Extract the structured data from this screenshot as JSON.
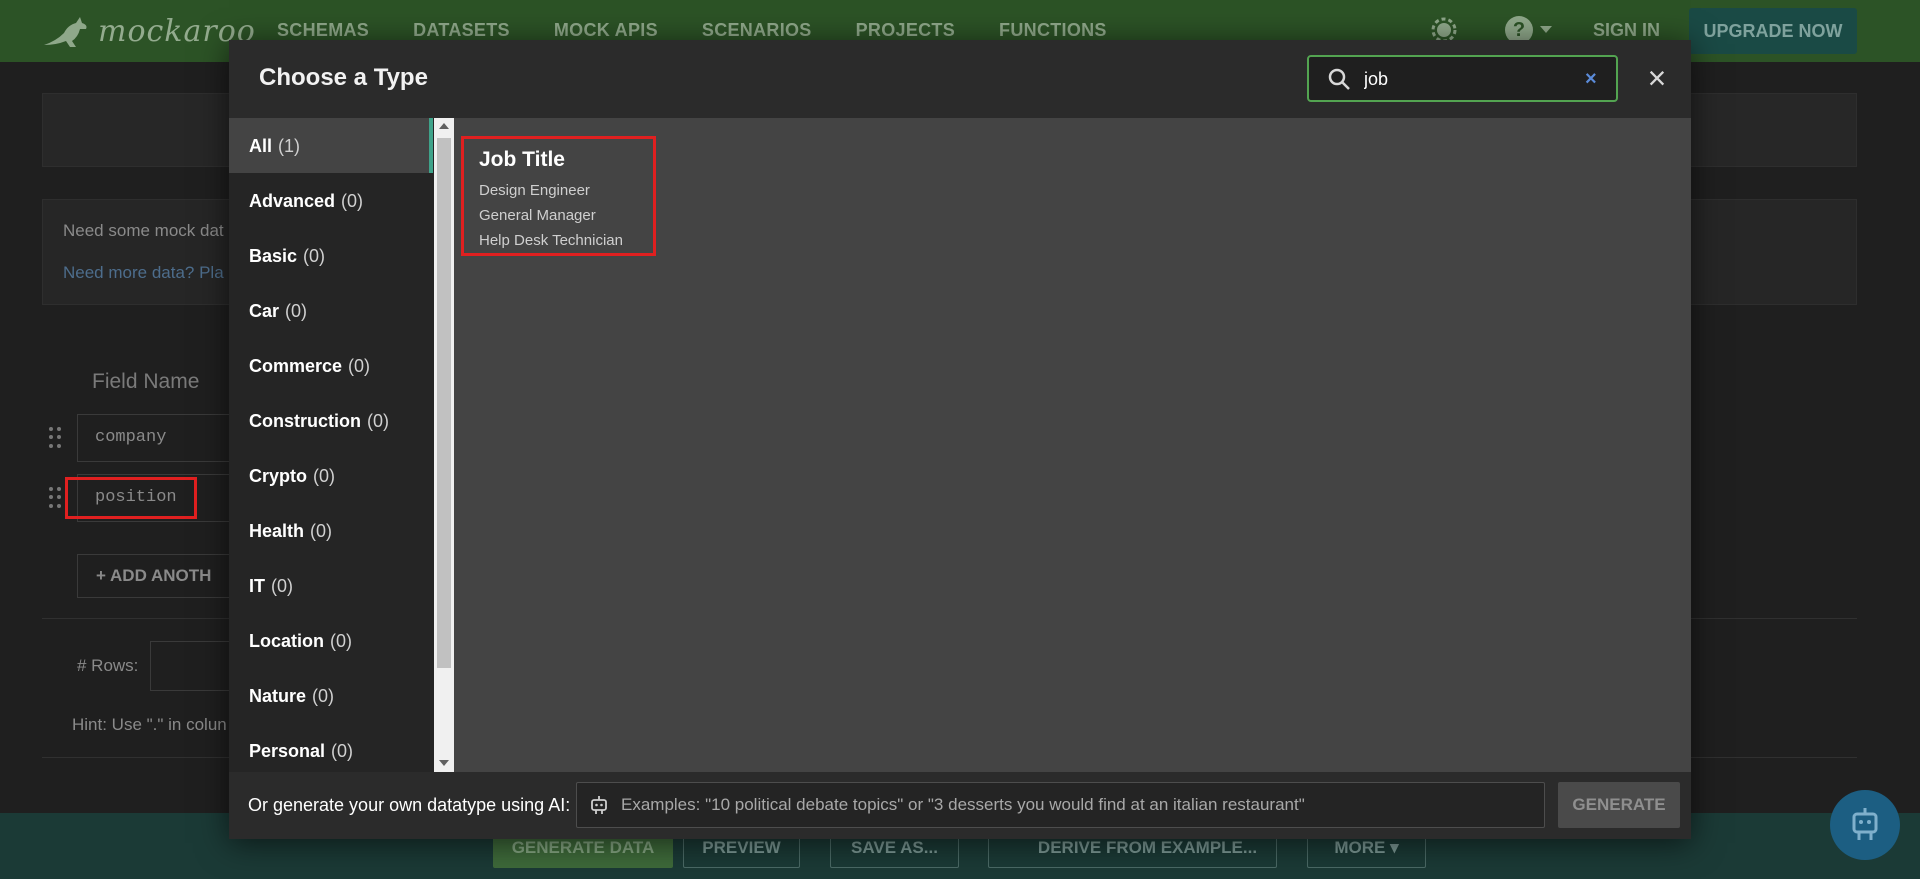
{
  "navbar": {
    "logo_text": "mockaroo",
    "links": [
      "SCHEMAS",
      "DATASETS",
      "MOCK APIS",
      "SCENARIOS",
      "PROJECTS",
      "FUNCTIONS"
    ],
    "sign_in": "SIGN IN",
    "upgrade": "UPGRADE NOW"
  },
  "background": {
    "notice_text": "Need some mock dat",
    "notice_link": "Need more data? Pla",
    "field_name_header": "Field Name",
    "fields": [
      "company",
      "position"
    ],
    "add_another": "ADD ANOTH",
    "rows_label": "# Rows:",
    "hint": "Hint: Use \".\" in colun"
  },
  "bottom_bar": {
    "generate_data": "GENERATE DATA",
    "preview": "PREVIEW",
    "save_as": "SAVE AS...",
    "derive": "DERIVE FROM EXAMPLE...",
    "more": "MORE"
  },
  "modal": {
    "title": "Choose a Type",
    "search_value": "job",
    "categories": [
      {
        "name": "All",
        "count": "(1)"
      },
      {
        "name": "Advanced",
        "count": "(0)"
      },
      {
        "name": "Basic",
        "count": "(0)"
      },
      {
        "name": "Car",
        "count": "(0)"
      },
      {
        "name": "Commerce",
        "count": "(0)"
      },
      {
        "name": "Construction",
        "count": "(0)"
      },
      {
        "name": "Crypto",
        "count": "(0)"
      },
      {
        "name": "Health",
        "count": "(0)"
      },
      {
        "name": "IT",
        "count": "(0)"
      },
      {
        "name": "Location",
        "count": "(0)"
      },
      {
        "name": "Nature",
        "count": "(0)"
      },
      {
        "name": "Personal",
        "count": "(0)"
      }
    ],
    "result": {
      "title": "Job Title",
      "examples": [
        "Design Engineer",
        "General Manager",
        "Help Desk Technician"
      ]
    },
    "footer": {
      "label": "Or generate your own datatype using AI:",
      "placeholder": "Examples: \"10 political debate topics\" or \"3 desserts you would find at an italian restaurant\"",
      "generate": "GENERATE"
    }
  },
  "colors": {
    "navbar": "#2c5326",
    "accent_green": "#53a451",
    "active_tab_indicator": "#3fa38a",
    "highlight_red": "#e02020"
  }
}
